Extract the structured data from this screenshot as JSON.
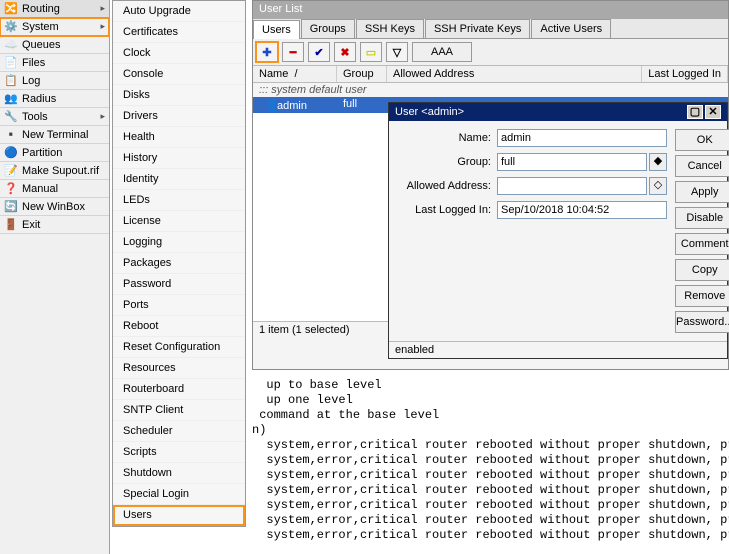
{
  "sidebar": {
    "items": [
      {
        "label": "Routing",
        "arrow": true
      },
      {
        "label": "System",
        "arrow": true,
        "highlight": true
      },
      {
        "label": "Queues"
      },
      {
        "label": "Files"
      },
      {
        "label": "Log"
      },
      {
        "label": "Radius"
      },
      {
        "label": "Tools",
        "arrow": true
      },
      {
        "label": "New Terminal"
      },
      {
        "label": "Partition"
      },
      {
        "label": "Make Supout.rif"
      },
      {
        "label": "Manual"
      },
      {
        "label": "New WinBox"
      },
      {
        "label": "Exit"
      }
    ]
  },
  "submenu": {
    "items": [
      "Auto Upgrade",
      "Certificates",
      "Clock",
      "Console",
      "Disks",
      "Drivers",
      "Health",
      "History",
      "Identity",
      "LEDs",
      "License",
      "Logging",
      "Packages",
      "Password",
      "Ports",
      "Reboot",
      "Reset Configuration",
      "Resources",
      "Routerboard",
      "SNTP Client",
      "Scheduler",
      "Scripts",
      "Shutdown",
      "Special Login",
      "Users"
    ],
    "highlight": "Users"
  },
  "userlist": {
    "title": "User List",
    "tabs": [
      "Users",
      "Groups",
      "SSH Keys",
      "SSH Private Keys",
      "Active Users"
    ],
    "active_tab": "Users",
    "toolbar": {
      "aaa": "AAA"
    },
    "columns": {
      "name": "Name",
      "group": "Group",
      "addr": "Allowed Address",
      "last": "Last Logged In"
    },
    "default_note": "::: system default user",
    "row": {
      "name": "admin",
      "group": "full"
    },
    "status": "1 item (1 selected)"
  },
  "dialog": {
    "title": "User <admin>",
    "fields": {
      "name_label": "Name:",
      "name_value": "admin",
      "group_label": "Group:",
      "group_value": "full",
      "addr_label": "Allowed Address:",
      "addr_value": "",
      "last_label": "Last Logged In:",
      "last_value": "Sep/10/2018 10:04:52"
    },
    "buttons": [
      "OK",
      "Cancel",
      "Apply",
      "Disable",
      "Comment",
      "Copy",
      "Remove",
      "Password..."
    ],
    "status": "enabled"
  },
  "console": {
    "lines": [
      "  up to base level",
      "  up one level",
      " command at the base level",
      "n)",
      "  system,error,critical router rebooted without proper shutdown, prob",
      "  system,error,critical router rebooted without proper shutdown, prob",
      "  system,error,critical router rebooted without proper shutdown, prob",
      "  system,error,critical router rebooted without proper shutdown, prob",
      "  system,error,critical router rebooted without proper shutdown, prob",
      "  system,error,critical router rebooted without proper shutdown, prob",
      "  system,error,critical router rebooted without proper shutdown, prob"
    ]
  }
}
